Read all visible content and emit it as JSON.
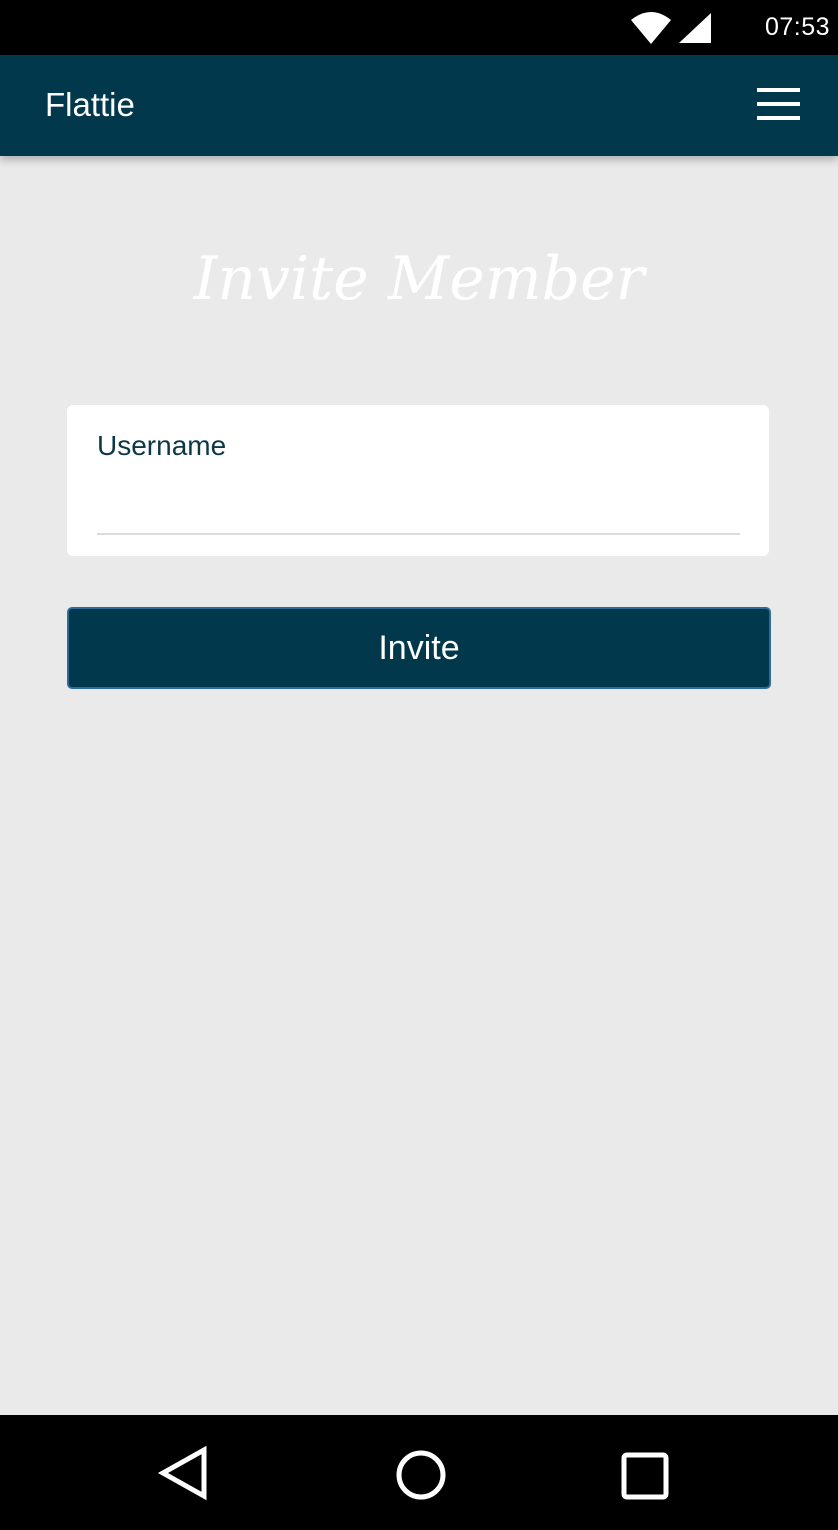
{
  "status_bar": {
    "time": "07:53",
    "wifi_icon": "wifi-icon",
    "signal_icon": "cell-signal-icon"
  },
  "app_bar": {
    "title": "Flattie",
    "menu_icon": "hamburger-menu-icon"
  },
  "page": {
    "heading": "Invite Member"
  },
  "form": {
    "username_label": "Username",
    "username_value": "",
    "username_placeholder": "",
    "invite_button_label": "Invite"
  },
  "nav_bar": {
    "back_icon": "back-triangle-icon",
    "home_icon": "home-circle-icon",
    "recents_icon": "recents-square-icon"
  },
  "colors": {
    "primary": "#02384b",
    "background": "#eaeaea",
    "card": "#ffffff",
    "label_text": "#0d3746",
    "button_border": "#2f6b9a"
  }
}
